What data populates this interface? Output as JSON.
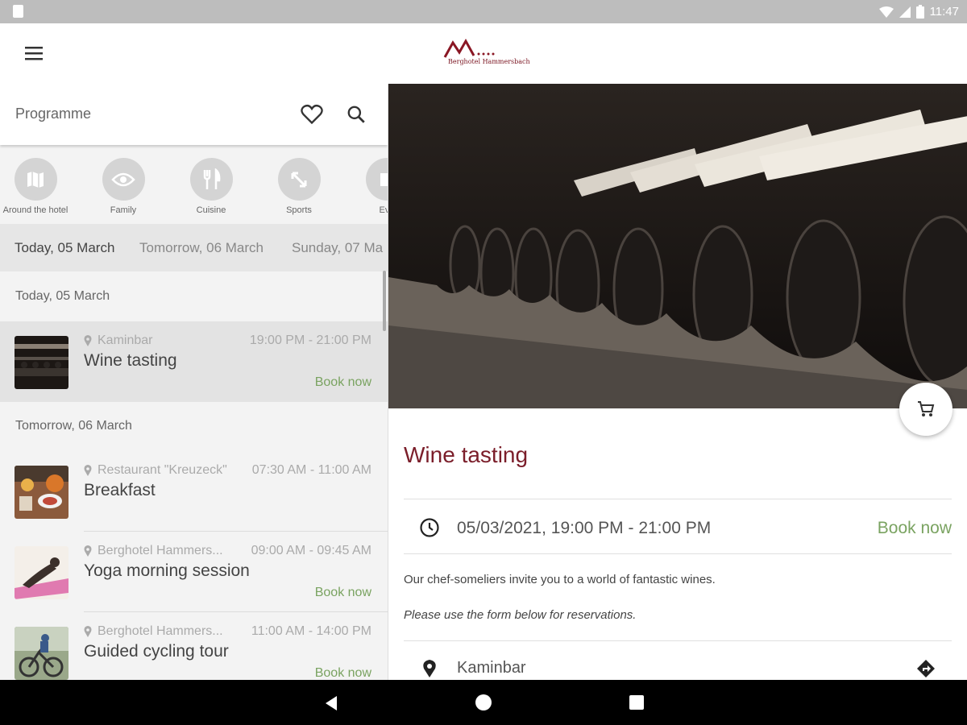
{
  "status_bar": {
    "time": "11:47"
  },
  "app": {
    "logo_text": "Berghotel Hammersbach"
  },
  "search": {
    "title": "Programme"
  },
  "categories": [
    {
      "label": "Around the hotel",
      "icon": "map-icon"
    },
    {
      "label": "Family",
      "icon": "eye-icon"
    },
    {
      "label": "Cuisine",
      "icon": "cutlery-icon"
    },
    {
      "label": "Sports",
      "icon": "arrows-expand-icon"
    },
    {
      "label": "Eve",
      "icon": "event-icon"
    }
  ],
  "date_tabs": [
    {
      "label": "Today, 05 March",
      "active": true
    },
    {
      "label": "Tomorrow, 06 March",
      "active": false
    },
    {
      "label": "Sunday, 07 Ma",
      "active": false
    }
  ],
  "sections": [
    {
      "header": "Today, 05 March",
      "events": [
        {
          "location": "Kaminbar",
          "time": "19:00 PM - 21:00 PM",
          "name": "Wine tasting",
          "action": "Book now",
          "selected": true
        }
      ]
    },
    {
      "header": "Tomorrow, 06 March",
      "events": [
        {
          "location": "Restaurant \"Kreuzeck\"",
          "time": "07:30 AM - 11:00 AM",
          "name": "Breakfast",
          "action": ""
        },
        {
          "location": "Berghotel Hammers...",
          "time": "09:00 AM - 09:45 AM",
          "name": "Yoga morning session",
          "action": "Book now"
        },
        {
          "location": "Berghotel Hammers...",
          "time": "11:00 AM - 14:00 PM",
          "name": "Guided cycling tour",
          "action": "Book now"
        }
      ]
    }
  ],
  "detail": {
    "title": "Wine tasting",
    "datetime": "05/03/2021, 19:00 PM - 21:00 PM",
    "action": "Book now",
    "description": "Our chef-someliers invite you to a world of fantastic wines.",
    "note": "Please use the form below for reservations.",
    "location": "Kaminbar"
  },
  "colors": {
    "accent_title": "#7b1e2a",
    "book_green": "#7aa361"
  }
}
